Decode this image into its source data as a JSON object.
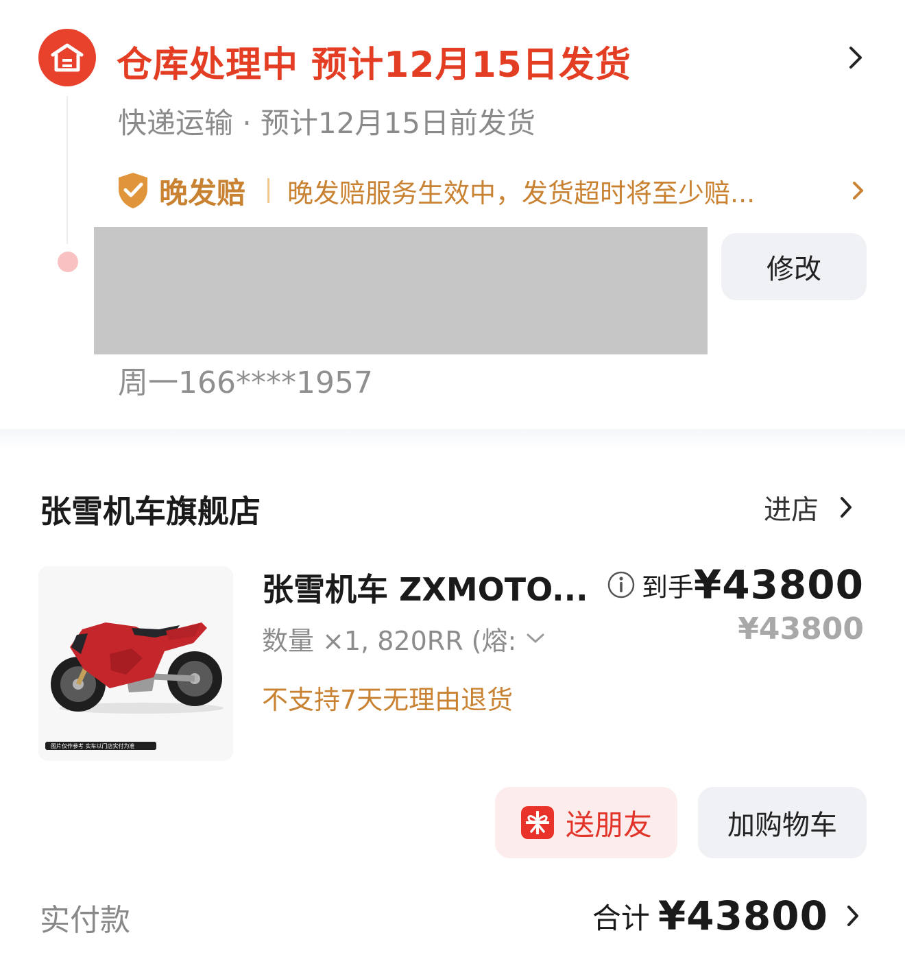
{
  "logistics": {
    "status_title": "仓库处理中 预计12月15日发货",
    "status_sub": "快递运输 · 预计12月15日前发货",
    "late_guarantee_label": "晚发赔",
    "late_guarantee_desc": "晚发赔服务生效中，发货超时将至少赔...",
    "edit_label": "修改",
    "contact": "周一166****1957"
  },
  "shop": {
    "name": "张雪机车旗舰店",
    "enter_label": "进店"
  },
  "product": {
    "title": "张雪机车 ZXMOTO...",
    "spec": "数量 ×1, 820RR (熔:",
    "return_policy": "不支持7天无理由退货",
    "image_caption": "图片仅作参考 实车以门店实付为准",
    "price_label": "到手",
    "price_final": "¥43800",
    "price_original": "¥43800"
  },
  "actions": {
    "gift_label": "送朋友",
    "cart_label": "加购物车"
  },
  "summary": {
    "paid_label": "实付款",
    "total_label": "合计",
    "total_value": "¥43800"
  },
  "colors": {
    "accent_red": "#e33e24",
    "warning_orange": "#c98232",
    "muted_gray": "#8a8a8a"
  },
  "icons": {
    "status": "warehouse-icon",
    "guarantee": "shield-check-icon",
    "gift": "gift-icon",
    "info": "info-icon",
    "chevron": "chevron-right-icon"
  }
}
